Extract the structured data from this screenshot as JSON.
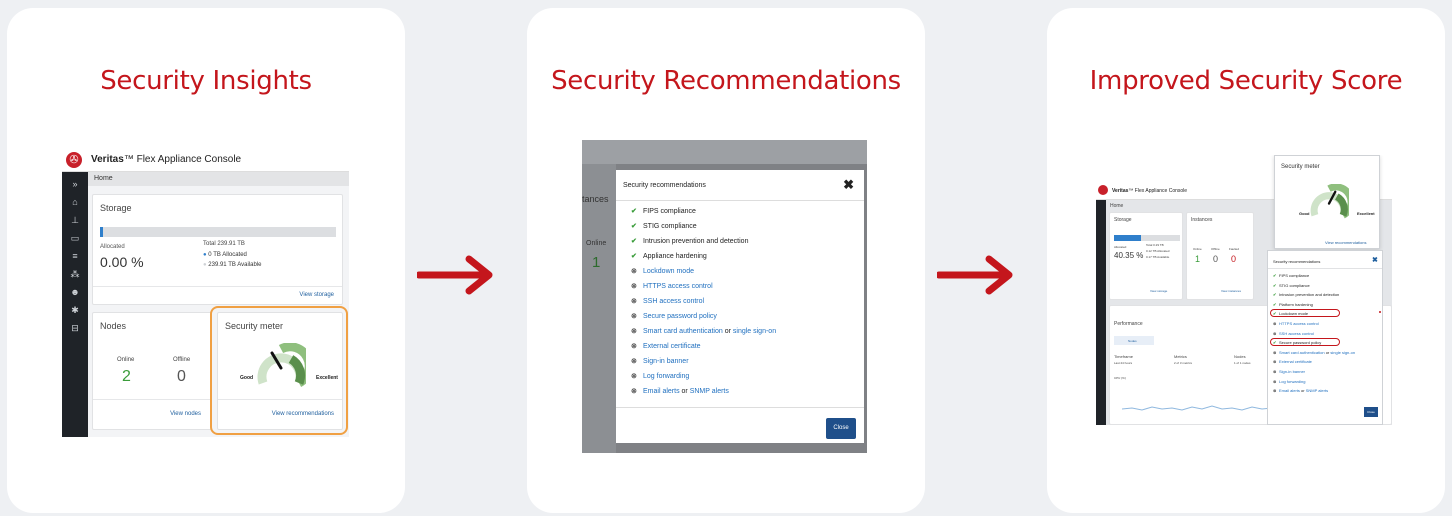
{
  "cards": [
    {
      "title": "Security Insights"
    },
    {
      "title": "Security Recommendations"
    },
    {
      "title": "Improved Security Score"
    }
  ],
  "colors": {
    "accent": "#c4161c",
    "highlight": "#f0a043",
    "check": "#3a9c3a",
    "link": "#1f6fbf",
    "dialog_close": "#1f4f8a"
  },
  "insights": {
    "brand_name": "Veritas",
    "brand_mark": "™",
    "brand_product": " Flex Appliance Console",
    "breadcrumb": "Home",
    "storage": {
      "title": "Storage",
      "allocated_label": "Allocated",
      "allocated_value": "0.00 %",
      "allocated_fraction": 0.0,
      "total": "Total 239.91 TB",
      "legend_allocated": "0 TB Allocated",
      "legend_available": "239.91 TB Available",
      "link": "View storage"
    },
    "nodes": {
      "title": "Nodes",
      "online_label": "Online",
      "online_value": "2",
      "offline_label": "Offline",
      "offline_value": "0",
      "link": "View nodes"
    },
    "meter": {
      "title": "Security meter",
      "good": "Good",
      "excellent": "Excellent",
      "link": "View recommendations"
    },
    "sidebar_icons": [
      "expand-icon",
      "home-icon",
      "topology-icon",
      "monitor-icon",
      "storage-icon",
      "share-icon",
      "users-icon",
      "settings-icon",
      "archive-icon"
    ]
  },
  "recommendations_dialog": {
    "background_instances": "Instances",
    "background_online": "Online",
    "background_online_value": "1",
    "title": "Security recommendations",
    "close_label": "Close",
    "items": [
      {
        "status": "done",
        "text": "FIPS compliance"
      },
      {
        "status": "done",
        "text": "STIG compliance"
      },
      {
        "status": "done",
        "text": "Intrusion prevention and detection"
      },
      {
        "status": "done",
        "text": "Appliance hardening"
      },
      {
        "status": "todo",
        "text": "Lockdown mode"
      },
      {
        "status": "todo",
        "text": "HTTPS access control"
      },
      {
        "status": "todo",
        "text": "SSH access control"
      },
      {
        "status": "todo",
        "text": "Secure password policy"
      },
      {
        "status": "todo",
        "text": "Smart card authentication",
        "joiner": " or ",
        "text2": "single sign-on"
      },
      {
        "status": "todo",
        "text": "External certificate"
      },
      {
        "status": "todo",
        "text": "Sign-in banner"
      },
      {
        "status": "todo",
        "text": "Log forwarding"
      },
      {
        "status": "todo",
        "text": "Email alerts",
        "joiner": " or ",
        "text2": "SNMP alerts"
      }
    ]
  },
  "improved": {
    "brand_name": "Veritas",
    "brand_product": "™ Flex Appliance Console",
    "breadcrumb": "Home",
    "meter_title": "Security meter",
    "good": "Good",
    "excellent": "Excellent",
    "view_recommendations": "View recommendations",
    "storage_title": "Storage",
    "allocated_label": "Allocated",
    "allocated_value": "40.35 %",
    "allocated_fraction": 0.4035,
    "total": "Total 0.29 TB",
    "legend_allocated": "0.12 TB Allocated",
    "legend_available": "0.17 TB Available",
    "view_storage": "View storage",
    "instances_title": "Instances",
    "online_label": "Online",
    "offline_label": "Offline",
    "faulted_label": "Faulted",
    "online_value": "1",
    "offline_value": "0",
    "faulted_value": "0",
    "view_instances": "View instances",
    "performance_title": "Performance",
    "nodes_tab": "Nodes",
    "timeframe_label": "Timeframe",
    "timeframe_value": "Last 24 hours",
    "metrics_label": "Metrics",
    "metrics_value": "2 of 3 metrics",
    "nodes_label": "Nodes",
    "nodes_value": "1 of 1 nodes",
    "cpu_label": "CPU (%)",
    "dialog_title": "Security recommendations",
    "close_label": "Close",
    "items": [
      {
        "status": "done",
        "text": "FIPS compliance"
      },
      {
        "status": "done",
        "text": "STIG compliance"
      },
      {
        "status": "done",
        "text": "Intrusion prevention and detection"
      },
      {
        "status": "done",
        "text": "Platform hardening"
      },
      {
        "status": "done",
        "text": "Lockdown mode",
        "circled": true
      },
      {
        "status": "todo",
        "text": "HTTPS access control"
      },
      {
        "status": "todo",
        "text": "SSH access control"
      },
      {
        "status": "done",
        "text": "Secure password policy",
        "circled": true
      },
      {
        "status": "todo",
        "text": "Smart card authentication",
        "joiner": " or ",
        "text2": "single sign-on"
      },
      {
        "status": "todo",
        "text": "External certificate"
      },
      {
        "status": "todo",
        "text": "Sign-in banner"
      },
      {
        "status": "todo",
        "text": "Log forwarding"
      },
      {
        "status": "todo",
        "text": "Email alerts",
        "joiner": " or ",
        "text2": "SNMP alerts"
      }
    ]
  }
}
